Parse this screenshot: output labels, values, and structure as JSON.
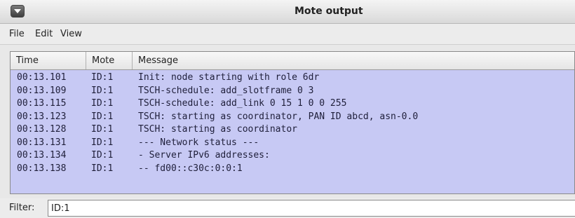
{
  "window": {
    "title": "Mote output"
  },
  "menu": {
    "items": [
      "File",
      "Edit",
      "View"
    ]
  },
  "table": {
    "columns": [
      "Time",
      "Mote",
      "Message"
    ],
    "rows": [
      {
        "time": "00:13.101",
        "mote": "ID:1",
        "message": "Init: node starting with role 6dr"
      },
      {
        "time": "00:13.109",
        "mote": "ID:1",
        "message": "TSCH-schedule: add_slotframe 0 3"
      },
      {
        "time": "00:13.115",
        "mote": "ID:1",
        "message": "TSCH-schedule: add_link 0 15 1 0 0 255"
      },
      {
        "time": "00:13.123",
        "mote": "ID:1",
        "message": "TSCH: starting as coordinator, PAN ID abcd, asn-0.0"
      },
      {
        "time": "00:13.128",
        "mote": "ID:1",
        "message": "TSCH: starting as coordinator"
      },
      {
        "time": "00:13.131",
        "mote": "ID:1",
        "message": "--- Network status ---"
      },
      {
        "time": "00:13.134",
        "mote": "ID:1",
        "message": "- Server IPv6 addresses:"
      },
      {
        "time": "00:13.138",
        "mote": "ID:1",
        "message": "-- fd00::c30c:0:0:1"
      }
    ]
  },
  "filter": {
    "label": "Filter:",
    "value": "ID:1"
  }
}
